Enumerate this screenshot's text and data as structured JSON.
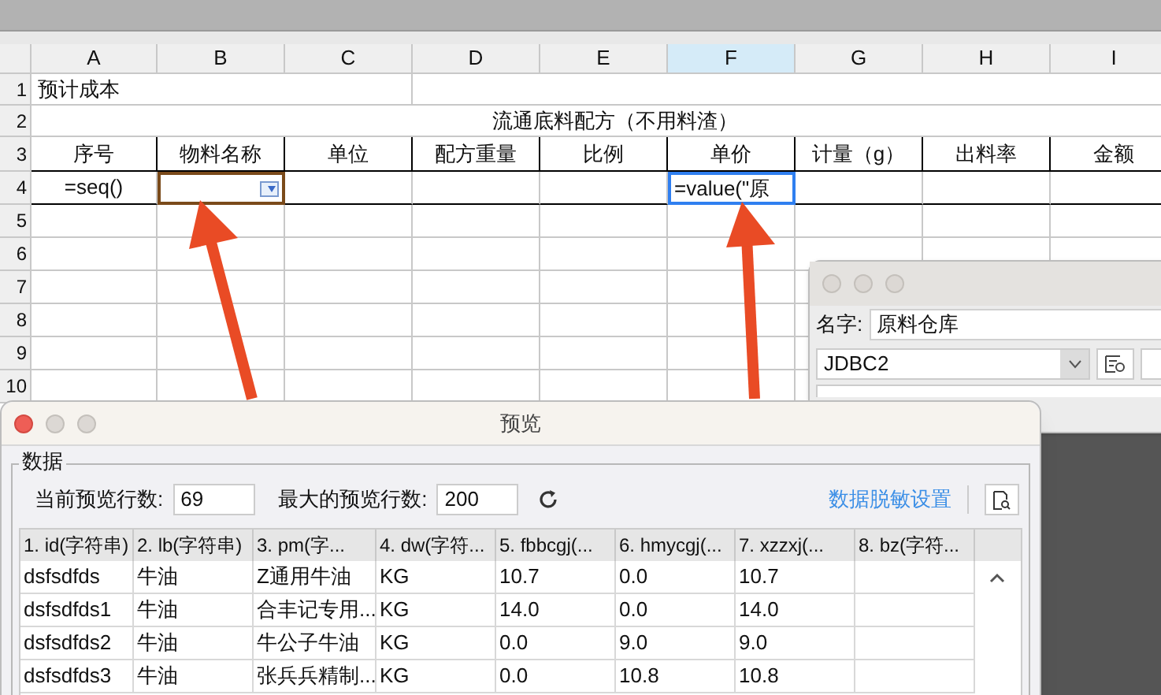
{
  "sheet": {
    "columns": [
      {
        "letter": "A",
        "selected": false
      },
      {
        "letter": "B",
        "selected": false
      },
      {
        "letter": "C",
        "selected": false
      },
      {
        "letter": "D",
        "selected": false
      },
      {
        "letter": "E",
        "selected": false
      },
      {
        "letter": "F",
        "selected": true
      },
      {
        "letter": "G",
        "selected": false
      },
      {
        "letter": "H",
        "selected": false
      },
      {
        "letter": "I",
        "selected": false
      }
    ],
    "row_numbers": [
      "1",
      "2",
      "3",
      "4",
      "5",
      "6",
      "7",
      "8",
      "9",
      "10"
    ],
    "title_cell": "预计成本",
    "merged_heading": "流通底料配方（不用料渣）",
    "headers": [
      "序号",
      "物料名称",
      "单位",
      "配方重量",
      "比例",
      "单价",
      "计量（g）",
      "出料率",
      "金额"
    ],
    "formula_row": [
      {
        "kind": "formula",
        "text": "=seq()"
      },
      {
        "kind": "dropdown"
      },
      {
        "kind": "blank"
      },
      {
        "kind": "blank"
      },
      {
        "kind": "blank"
      },
      {
        "kind": "active",
        "text": "=value(\"原"
      },
      {
        "kind": "blank"
      },
      {
        "kind": "blank"
      },
      {
        "kind": "blank"
      }
    ]
  },
  "datasource_window": {
    "name_label": "名字:",
    "name_value": "原料仓库",
    "connection": "JDBC2"
  },
  "preview_window": {
    "title": "预览",
    "group_label": "数据",
    "current_rows_label": "当前预览行数:",
    "current_rows": "69",
    "max_rows_label": "最大的预览行数:",
    "max_rows": "200",
    "masking_link": "数据脱敏设置",
    "columns": [
      "1. id(字符串)",
      "2. lb(字符串)",
      "3. pm(字...",
      "4. dw(字符...",
      "5. fbbcgj(...",
      "6. hmycgj(...",
      "7. xzzxj(...",
      "8. bz(字符..."
    ],
    "rows": [
      [
        "dsfsdfds",
        "牛油",
        "Z通用牛油",
        "KG",
        "10.7",
        "0.0",
        "10.7",
        ""
      ],
      [
        "dsfsdfds1",
        "牛油",
        "合丰记专用...",
        "KG",
        "14.0",
        "0.0",
        "14.0",
        ""
      ],
      [
        "dsfsdfds2",
        "牛油",
        "牛公子牛油",
        "KG",
        "0.0",
        "9.0",
        "9.0",
        ""
      ],
      [
        "dsfsdfds3",
        "牛油",
        "张兵兵精制...",
        "KG",
        "0.0",
        "10.8",
        "10.8",
        ""
      ]
    ]
  }
}
